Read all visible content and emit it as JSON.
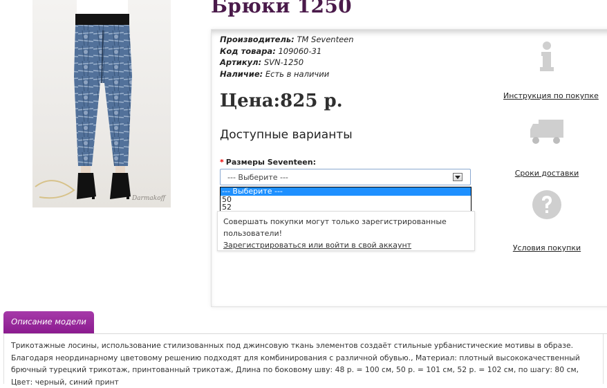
{
  "product": {
    "title": "Брюки 1250",
    "photo_signature": "Darmakoff"
  },
  "meta": [
    {
      "key": "Производитель:",
      "value": "TM Seventeen"
    },
    {
      "key": "Код товара:",
      "value": "109060-31"
    },
    {
      "key": "Артикул:",
      "value": "SVN-1250"
    },
    {
      "key": "Наличие:",
      "value": "Есть в наличии"
    }
  ],
  "price": "Цена:825 р.",
  "variants": {
    "title": "Доступные варианты",
    "required_mark": "*",
    "option_label": "Размеры Seventeen:",
    "selected": "--- Выберите ---",
    "options": [
      "--- Выберите ---",
      "50",
      "52"
    ]
  },
  "notice": {
    "text": "Совершать покупки могут только зарегистрированные пользователи!",
    "link": "Зарегистрироваться или войти в свой аккаунт"
  },
  "sidebar": [
    {
      "icon": "info-icon",
      "label": "Инструкция по покупке"
    },
    {
      "icon": "truck-icon",
      "label": "Сроки доставки"
    },
    {
      "icon": "question-icon",
      "label": "Условия покупки"
    }
  ],
  "description": {
    "tab_label": "Описание модели",
    "text": "Трикотажные лосины, использование стилизованных под джинсовую ткань элементов создаёт стильные урбанистические мотивы в образе. Благодаря неординарному цветовому решению подходят для комбинирования с различной обувью., Материал: плотный высококачественный брючный турецкий трикотаж, принтованный трикотаж, Длина по боковому шву: 48 р. = 100 см, 50 р. = 101 см, 52 р. = 102 см, по шагу: 80 см, Цвет: черный, синий принт"
  }
}
